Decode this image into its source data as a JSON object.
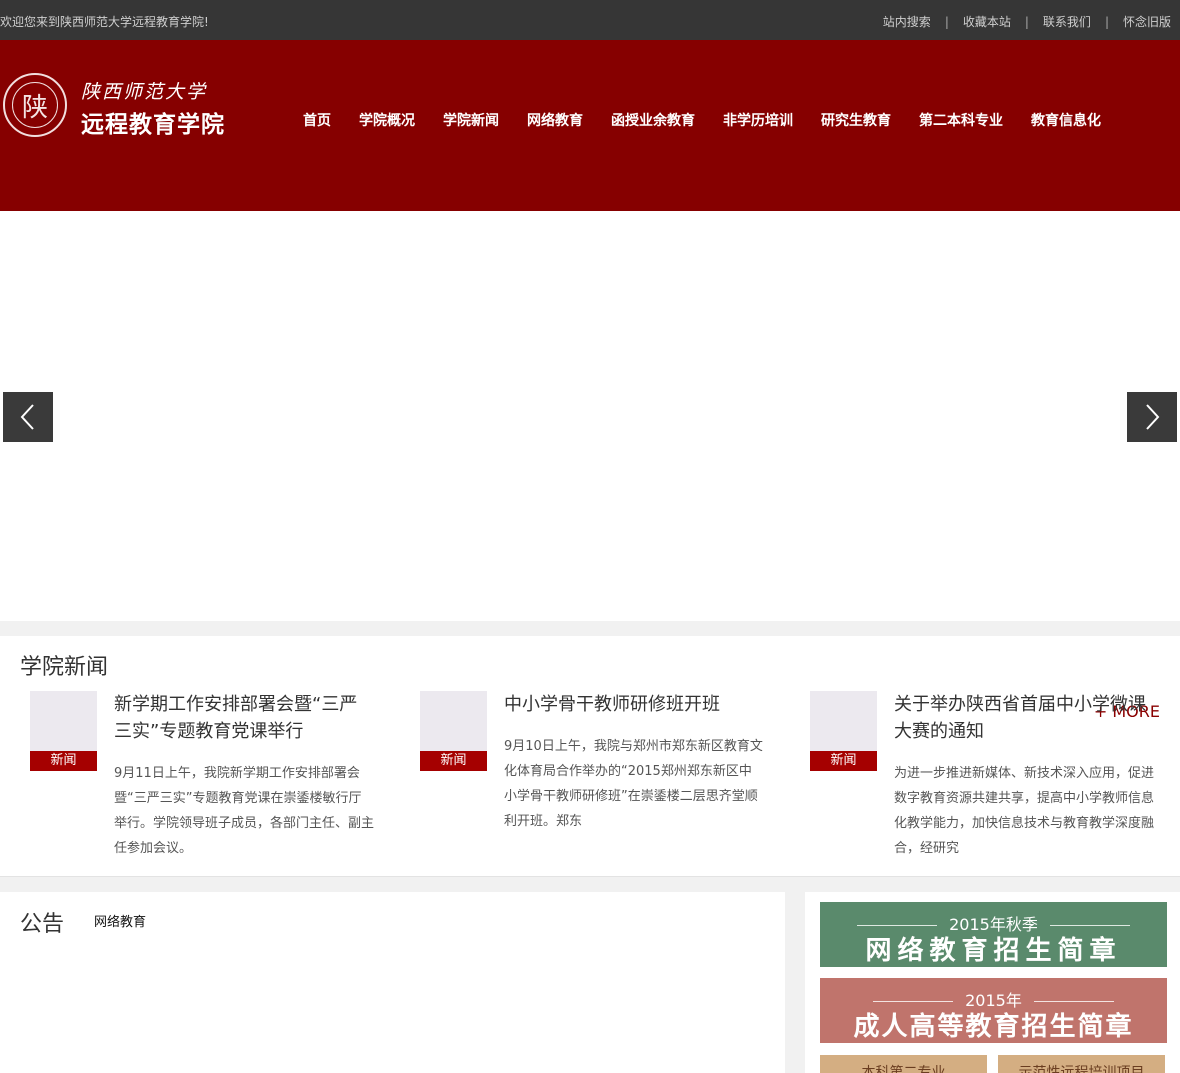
{
  "topbar": {
    "welcome": "欢迎您来到陕西师范大学远程教育学院!",
    "links": [
      "站内搜索",
      "收藏本站",
      "联系我们",
      "怀念旧版"
    ],
    "separator": "|"
  },
  "header": {
    "logo_top": "陕西师范大学",
    "logo_bottom": "远程教育学院",
    "seal_char": "陕",
    "brand_color": "#860000",
    "nav": [
      "首页",
      "学院概况",
      "学院新闻",
      "网络教育",
      "函授业余教育",
      "非学历培训",
      "研究生教育",
      "第二本科专业",
      "教育信息化"
    ]
  },
  "banner": {
    "prev_icon": "chevron-left-icon",
    "next_icon": "chevron-right-icon"
  },
  "news": {
    "title": "学院新闻",
    "more": "+ MORE",
    "items": [
      {
        "tag": "新闻",
        "title": "新学期工作安排部署会暨“三严三实”专题教育党课举行",
        "desc": "9月11日上午，我院新学期工作安排部署会暨“三严三实”专题教育党课在崇鋈楼敏行厅举行。学院领导班子成员，各部门主任、副主任参加会议。"
      },
      {
        "tag": "新闻",
        "title": "中小学骨干教师研修班开班",
        "desc": "9月10日上午，我院与郑州市郑东新区教育文化体育局合作举办的“2015郑州郑东新区中小学骨干教师研修班”在崇鋈楼二层思齐堂顺利开班。郑东"
      },
      {
        "tag": "新闻",
        "title": "关于举办陕西省首届中小学微课大赛的通知",
        "desc": "为进一步推进新媒体、新技术深入应用，促进数字教育资源共建共享，提高中小学教师信息化教学能力，加快信息技术与教育教学深度融合，经研究"
      }
    ]
  },
  "notice": {
    "title": "公告",
    "tab": "网络教育"
  },
  "side": {
    "promo1": {
      "year": "2015年秋季",
      "text": "网络教育招生简章",
      "color": "#5a8a6c"
    },
    "promo2": {
      "year": "2015年",
      "text": "成人高等教育招生简章",
      "color": "#c0746c"
    },
    "tile1": "本科第二专业",
    "tile2": "示范性远程培训项目"
  }
}
